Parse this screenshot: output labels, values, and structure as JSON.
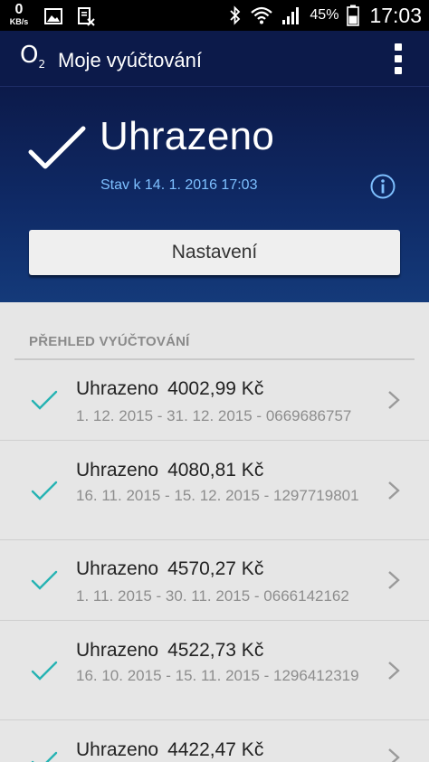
{
  "status_bar": {
    "net_speed_value": "0",
    "net_speed_unit": "KB/s",
    "battery_percent": "45%",
    "time": "17:03",
    "icons": [
      "image-icon",
      "storage-full-icon",
      "bluetooth-icon",
      "wifi-icon",
      "signal-icon",
      "battery-icon"
    ]
  },
  "app_bar": {
    "logo_text": "O",
    "logo_sub": "2",
    "title": "Moje vyúčtování",
    "menu_icon": "overflow-menu-icon"
  },
  "hero": {
    "status": "Uhrazeno",
    "date_text": "Stav k 14. 1. 2016 17:03",
    "settings_label": "Nastavení"
  },
  "overview": {
    "header": "PŘEHLED VYÚČTOVÁNÍ",
    "items": [
      {
        "status": "Uhrazeno",
        "amount": "4002,99 Kč",
        "detail": "1. 12. 2015 - 31. 12. 2015 - 0669686757"
      },
      {
        "status": "Uhrazeno",
        "amount": "4080,81 Kč",
        "detail": "16. 11. 2015 - 15. 12. 2015 - 1297719801"
      },
      {
        "status": "Uhrazeno",
        "amount": "4570,27 Kč",
        "detail": "1. 11. 2015 - 30. 11. 2015 - 0666142162"
      },
      {
        "status": "Uhrazeno",
        "amount": "4522,73 Kč",
        "detail": "16. 10. 2015 - 15. 11. 2015 - 1296412319"
      },
      {
        "status": "Uhrazeno",
        "amount": "4422,47 Kč",
        "detail": ""
      }
    ]
  },
  "colors": {
    "header_bg": "#0c1a4a",
    "check_teal": "#26b3b3",
    "date_blue": "#7ec0ff"
  }
}
